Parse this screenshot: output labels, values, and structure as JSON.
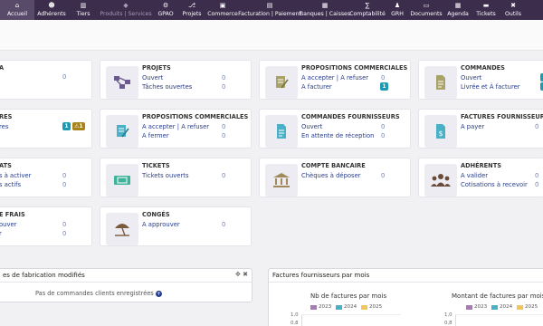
{
  "nav": {
    "items": [
      {
        "label": "Accueil",
        "icon": "home-icon",
        "glyph": "⌂"
      },
      {
        "label": "Adhérents",
        "icon": "users-icon",
        "glyph": "☻"
      },
      {
        "label": "Tiers",
        "icon": "building-icon",
        "glyph": "▥"
      },
      {
        "label": "Produits | Services",
        "icon": "cube-icon",
        "glyph": "◆"
      },
      {
        "label": "GPAO",
        "icon": "gear-icon",
        "glyph": "⚙"
      },
      {
        "label": "Projets",
        "icon": "sitemap-icon",
        "glyph": "⎇"
      },
      {
        "label": "Commerce",
        "icon": "suitcase-icon",
        "glyph": "▣"
      },
      {
        "label": "Facturation | Paiement",
        "icon": "invoice-icon",
        "glyph": "▤"
      },
      {
        "label": "Banques | Caisses",
        "icon": "bank-icon",
        "glyph": "▦"
      },
      {
        "label": "Comptabilité",
        "icon": "accounting-icon",
        "glyph": "∑"
      },
      {
        "label": "GRH",
        "icon": "hr-icon",
        "glyph": "♟"
      },
      {
        "label": "Documents",
        "icon": "folder-icon",
        "glyph": "▭"
      },
      {
        "label": "Agenda",
        "icon": "calendar-icon",
        "glyph": "▦"
      },
      {
        "label": "Tickets",
        "icon": "ticket-icon",
        "glyph": "▬"
      },
      {
        "label": "Outils",
        "icon": "tools-icon",
        "glyph": "✖"
      }
    ]
  },
  "cards": {
    "c1": {
      "title": "A",
      "lines": [
        {
          "label": "",
          "value": "0"
        }
      ]
    },
    "c2": {
      "title": "RES",
      "lines": [
        {
          "label": "res"
        }
      ],
      "badge1": "1",
      "badge2": "1"
    },
    "c3": {
      "title": "ATS",
      "lines": [
        {
          "label": "s à activer",
          "value": "0"
        },
        {
          "label": "s actifs",
          "value": "0"
        }
      ]
    },
    "c4": {
      "title": "E FRAIS",
      "lines": [
        {
          "label": "ouver",
          "value": "0"
        },
        {
          "label": "r",
          "value": "0"
        }
      ]
    },
    "projets": {
      "title": "PROJETS",
      "lines": [
        {
          "label": "Ouvert",
          "value": "0"
        },
        {
          "label": "Tâches ouvertes",
          "value": "0"
        }
      ]
    },
    "propfou": {
      "title": "PROPOSITIONS COMMERCIALES FOU...",
      "lines": [
        {
          "label": "A accepter | A refuser",
          "value": "0"
        },
        {
          "label": "A fermer",
          "value": "0"
        }
      ]
    },
    "tickets": {
      "title": "TICKETS",
      "lines": [
        {
          "label": "Tickets ouverts",
          "value": "0"
        }
      ]
    },
    "conges": {
      "title": "CONGÉS",
      "lines": [
        {
          "label": "A approuver",
          "value": "0"
        }
      ]
    },
    "propcom": {
      "title": "PROPOSITIONS COMMERCIALES",
      "lines": [
        {
          "label": "A accepter | A refuser",
          "value": "0"
        },
        {
          "label": "A facturer",
          "badge": "1"
        }
      ]
    },
    "cmdfou": {
      "title": "COMMANDES FOURNISSEURS",
      "lines": [
        {
          "label": "Ouvert",
          "value": "0"
        },
        {
          "label": "En attente de réception",
          "value": "0"
        }
      ]
    },
    "banque": {
      "title": "COMPTE BANCAIRE",
      "lines": [
        {
          "label": "Chèques à déposer",
          "value": "0"
        }
      ]
    },
    "commandes": {
      "title": "COMMANDES",
      "lines": [
        {
          "label": "Ouvert"
        },
        {
          "label": "Livrée et À facturer"
        }
      ]
    },
    "factfou": {
      "title": "FACTURES FOURNISSEUR",
      "lines": [
        {
          "label": "A payer",
          "value": "0"
        }
      ]
    },
    "adherents": {
      "title": "ADHÉRENTS",
      "lines": [
        {
          "label": "A valider",
          "value": "0"
        },
        {
          "label": "Cotisations à recevoir",
          "value": "0"
        }
      ]
    }
  },
  "widget_left": {
    "title": "es de fabrication modifiés",
    "empty_text": "Pas de commandes clients enregistrées"
  },
  "widget_right": {
    "title": "Factures fournisseurs par mois",
    "charts": [
      {
        "subtitle": "Nb de factures par mois",
        "legend": [
          "2023",
          "2024",
          "2025"
        ],
        "yticks": [
          "1,0",
          "0,8"
        ]
      },
      {
        "subtitle": "Montant de factures par mois (H",
        "legend": [
          "2023",
          "2024",
          "2025"
        ],
        "yticks": [
          "1,0",
          "0,8"
        ]
      }
    ]
  },
  "colors": {
    "nav_bg": "#3d2d4d",
    "link": "#263c8a",
    "teal": "#1d9ab3",
    "olive": "#a8821a",
    "y2023": "#a97bb6",
    "y2024": "#4ab0c5",
    "y2025": "#f2c45c"
  }
}
